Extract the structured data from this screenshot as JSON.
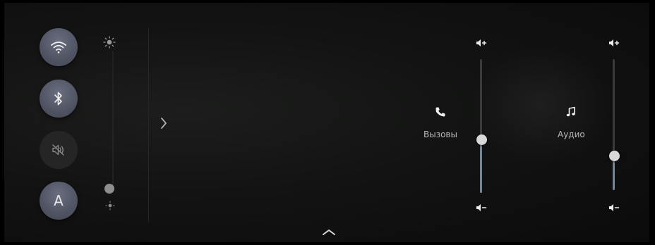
{
  "quick_controls": {
    "wifi": {
      "icon": "wifi-icon",
      "state": "on"
    },
    "bluetooth": {
      "icon": "bluetooth-icon",
      "state": "on"
    },
    "mute": {
      "icon": "speaker-mute-icon",
      "state": "off"
    },
    "auto": {
      "label": "A",
      "state": "on"
    }
  },
  "brightness": {
    "top_icon": "sun-icon",
    "bottom_icon": "sun-small-icon",
    "level": 0.0
  },
  "expand": {
    "icon": "chevron-right-icon"
  },
  "volume": {
    "calls": {
      "label": "Вызовы",
      "icon": "phone-icon",
      "level": 0.4,
      "up_icon": "volume-up-icon",
      "down_icon": "volume-down-icon"
    },
    "audio": {
      "label": "Аудио",
      "icon": "music-note-icon",
      "level": 0.26,
      "up_icon": "volume-up-icon",
      "down_icon": "volume-down-icon"
    }
  },
  "bottom_bar": {
    "icon": "chevron-up-icon"
  },
  "colors": {
    "accent_button": "#5a5e6d",
    "slider_fill": "#7a8594",
    "knob": "#d8d8d8"
  }
}
